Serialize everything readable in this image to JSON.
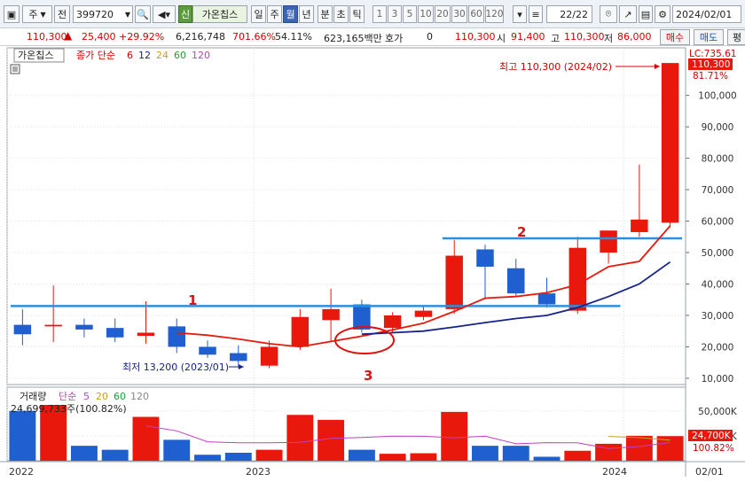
{
  "toolbar": {
    "market": "주",
    "prefix": "전",
    "code": "399720",
    "stock_badge": "신",
    "stock_name": "가온칩스",
    "periods": [
      "일",
      "주",
      "월",
      "년",
      "분",
      "초",
      "틱"
    ],
    "selected_period": "월",
    "intervals": [
      "1",
      "3",
      "5",
      "10",
      "20",
      "30",
      "60",
      "120"
    ],
    "page_counter": "22/22",
    "date": "2024/02/01"
  },
  "ticker": {
    "price": "110,300",
    "change": "25,400",
    "change_pct": "+29.92%",
    "volume": "6,216,748",
    "volume_pct": "701.66%",
    "turnover": "54.11%",
    "amount": "623,165백만",
    "quote_label": "호가",
    "quote_value": "0",
    "quote_price": "110,300",
    "open_label": "시",
    "open_value": "91,400",
    "high_label": "고",
    "high_value": "110,300",
    "low_label": "저",
    "low_value": "86,000",
    "buy_label": "매수",
    "sell_label": "매도",
    "eval_label": "평"
  },
  "legend": {
    "stock": "가온칩스",
    "ma_label": "종가 단순",
    "ma_periods": [
      "6",
      "12",
      "24",
      "60",
      "120"
    ]
  },
  "annotations": {
    "high": "최고 110,300 (2024/02)",
    "low": "최저 13,200 (2023/01)",
    "line1": "1",
    "line2": "2",
    "circle3": "3"
  },
  "price_axis": {
    "top_label": "LC:735.61",
    "current_tag": "110,300",
    "current_pct": "81.71%"
  },
  "volume_legend": {
    "label": "거래량",
    "ma_label": "단순",
    "periods": [
      "5",
      "20",
      "60",
      "120"
    ],
    "value": "24,699,733주(100.82%)"
  },
  "volume_axis": {
    "current_tag": "24,700K",
    "current_pct": "100.82%"
  },
  "x_axis_labels": [
    "2022",
    "2023",
    "2024",
    "02/01"
  ],
  "colors": {
    "up": "#e8190c",
    "down": "#1f5fd0",
    "ma6": "#e8190c",
    "ma12": "#16238c",
    "resistance": "#2b8fe0",
    "vol_ma5": "#c040c0",
    "vol_ma20": "#d0a020"
  },
  "chart_data": {
    "type": "candlestick",
    "y_ticks": [
      10000,
      20000,
      30000,
      40000,
      50000,
      60000,
      70000,
      80000,
      90000,
      100000
    ],
    "y_tick_labels": [
      "10,000",
      "20,000",
      "30,000",
      "40,000",
      "50,000",
      "60,000",
      "70,000",
      "80,000",
      "90,000",
      "100,000"
    ],
    "ylim": [
      8000,
      114000
    ],
    "candles": [
      {
        "o": 27000,
        "h": 32000,
        "l": 20500,
        "c": 24000
      },
      {
        "o": 26500,
        "h": 39500,
        "l": 21500,
        "c": 27000
      },
      {
        "o": 27000,
        "h": 29000,
        "l": 23000,
        "c": 25500
      },
      {
        "o": 26000,
        "h": 29000,
        "l": 21500,
        "c": 23000
      },
      {
        "o": 23500,
        "h": 34500,
        "l": 21000,
        "c": 24500
      },
      {
        "o": 26500,
        "h": 29000,
        "l": 18000,
        "c": 20000
      },
      {
        "o": 20000,
        "h": 22000,
        "l": 16500,
        "c": 17500
      },
      {
        "o": 18000,
        "h": 20500,
        "l": 14000,
        "c": 15500
      },
      {
        "o": 14000,
        "h": 22000,
        "l": 13200,
        "c": 20000
      },
      {
        "o": 20000,
        "h": 32000,
        "l": 19000,
        "c": 29500
      },
      {
        "o": 28500,
        "h": 38500,
        "l": 21500,
        "c": 32000
      },
      {
        "o": 33500,
        "h": 35000,
        "l": 24500,
        "c": 25500
      },
      {
        "o": 26000,
        "h": 31000,
        "l": 24500,
        "c": 30000
      },
      {
        "o": 29500,
        "h": 33000,
        "l": 28500,
        "c": 31500
      },
      {
        "o": 32000,
        "h": 54000,
        "l": 30500,
        "c": 49000
      },
      {
        "o": 51000,
        "h": 52500,
        "l": 35000,
        "c": 45500
      },
      {
        "o": 45000,
        "h": 48000,
        "l": 36000,
        "c": 37000
      },
      {
        "o": 37000,
        "h": 42000,
        "l": 32500,
        "c": 33500
      },
      {
        "o": 31500,
        "h": 55000,
        "l": 30500,
        "c": 51500
      },
      {
        "o": 50000,
        "h": 56500,
        "l": 46500,
        "c": 57000
      },
      {
        "o": 56500,
        "h": 78000,
        "l": 55000,
        "c": 60500
      },
      {
        "o": 59500,
        "h": 110300,
        "l": 58000,
        "c": 110300
      }
    ],
    "ma6": [
      null,
      null,
      null,
      null,
      null,
      24500,
      23700,
      22500,
      21000,
      20000,
      21700,
      23400,
      25400,
      27500,
      31300,
      35500,
      36000,
      37200,
      39800,
      45500,
      47200,
      58500
    ],
    "ma12": [
      null,
      null,
      null,
      null,
      null,
      null,
      null,
      null,
      null,
      null,
      null,
      24000,
      24500,
      25000,
      26300,
      27700,
      29000,
      30000,
      32500,
      36000,
      40000,
      47000
    ],
    "resistance_lines": [
      {
        "label": "1",
        "x0": 0,
        "x1": 20,
        "y": 33000
      },
      {
        "label": "2",
        "x0": 14,
        "x1": 22,
        "y": 54500
      }
    ],
    "volume": {
      "ylim": [
        0,
        56000
      ],
      "y_ticks": [
        25000,
        50000
      ],
      "y_tick_labels": [
        "25,000K",
        "50,000K"
      ],
      "values": [
        50000,
        56000,
        15000,
        11000,
        44000,
        21000,
        6000,
        8000,
        11000,
        46000,
        41000,
        11000,
        7000,
        7500,
        49000,
        15000,
        15000,
        4000,
        10000,
        17000,
        25000,
        24700
      ],
      "ma5": [
        null,
        null,
        null,
        null,
        35000,
        30000,
        19000,
        18000,
        18000,
        18400,
        22400,
        23400,
        24600,
        24500,
        23000,
        24600,
        17000,
        18100,
        18000,
        12200,
        14200,
        18300
      ],
      "ma20": [
        null,
        null,
        null,
        null,
        null,
        null,
        null,
        null,
        null,
        null,
        null,
        null,
        null,
        null,
        null,
        null,
        null,
        null,
        null,
        24400,
        23200,
        20700
      ]
    },
    "x_labels": [
      {
        "label": "2022",
        "index": 0
      },
      {
        "label": "2023",
        "index": 8
      },
      {
        "label": "2024",
        "index": 20
      }
    ]
  }
}
